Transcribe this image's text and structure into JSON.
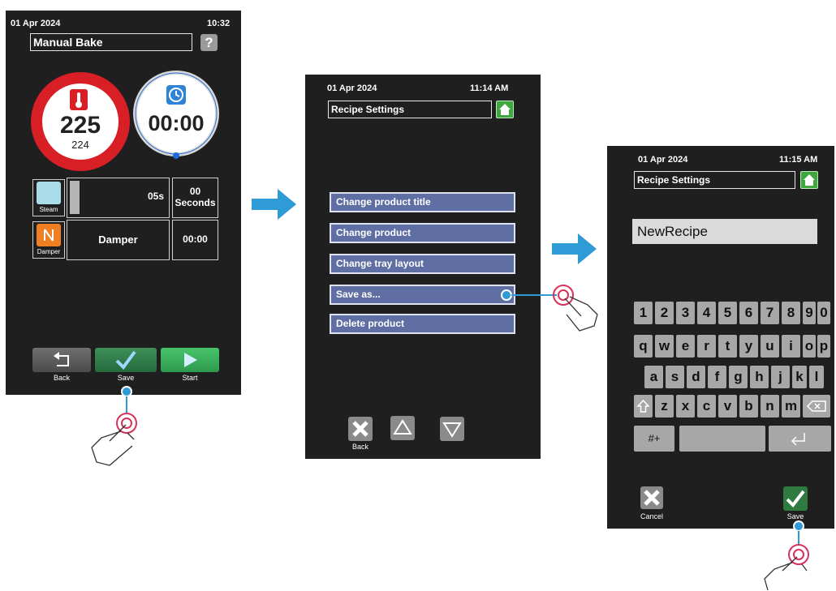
{
  "screen1": {
    "date": "01 Apr 2024",
    "time": "10:32",
    "title": "Manual Bake",
    "help_label": "?",
    "temp_set": "225",
    "temp_actual": "224",
    "timer": "00:00",
    "steam_label": "Steam",
    "steam_duration": "05s",
    "steam_value": "00",
    "steam_unit": "Seconds",
    "damper_label": "Damper",
    "damper_name": "Damper",
    "damper_time": "00:00",
    "back_label": "Back",
    "save_label": "Save",
    "start_label": "Start"
  },
  "screen2": {
    "date": "01 Apr 2024",
    "time": "11:14 AM",
    "title": "Recipe Settings",
    "menu": [
      "Change product title",
      "Change product",
      "Change tray layout",
      "Save as...",
      "Delete product"
    ],
    "back_label": "Back"
  },
  "screen3": {
    "date": "01 Apr 2024",
    "time": "11:15 AM",
    "title": "Recipe Settings",
    "input_value": "NewRecipe",
    "row1": [
      "1",
      "2",
      "3",
      "4",
      "5",
      "6",
      "7",
      "8",
      "9",
      "0"
    ],
    "row2": [
      "q",
      "w",
      "e",
      "r",
      "t",
      "y",
      "u",
      "i",
      "o",
      "p"
    ],
    "row3": [
      "a",
      "s",
      "d",
      "f",
      "g",
      "h",
      "j",
      "k",
      "l"
    ],
    "row4": [
      "z",
      "x",
      "c",
      "v",
      "b",
      "n",
      "m"
    ],
    "symbols_label": "#+",
    "cancel_label": "Cancel",
    "save_label": "Save"
  },
  "colors": {
    "arrow": "#2e9ad6",
    "temp_ring": "#d81f26",
    "home_green": "#3ea83e",
    "menu_blue": "#5f6ea3",
    "key_gray": "#a7a7a7",
    "screen_bg": "#1f1f1f"
  }
}
